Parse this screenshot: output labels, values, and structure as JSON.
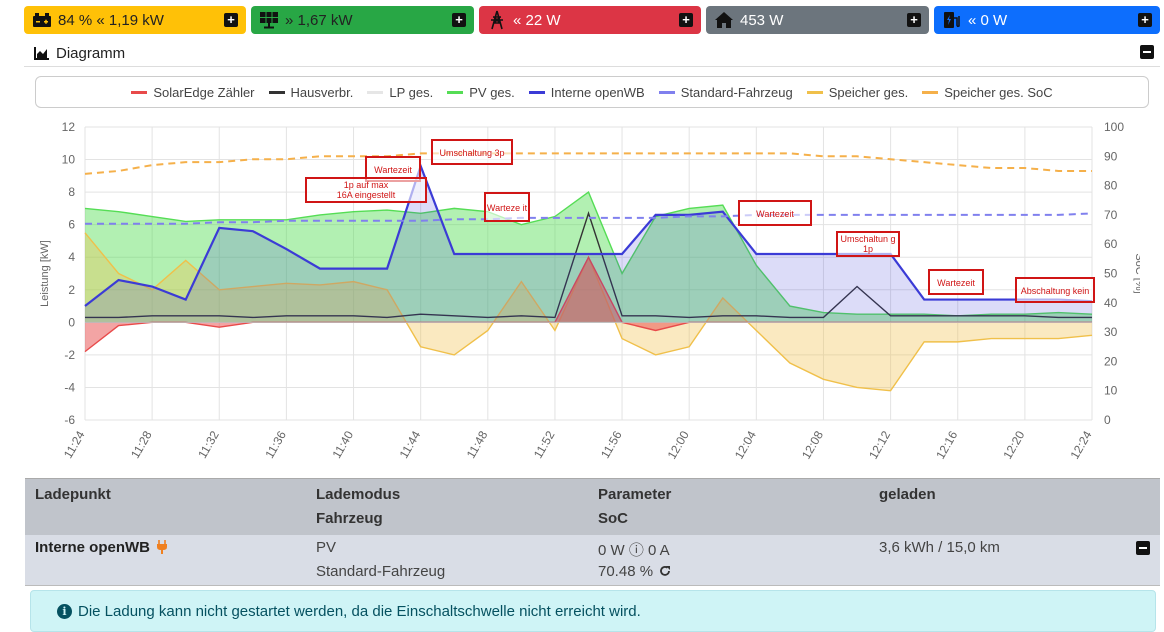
{
  "status_tiles": [
    {
      "name": "battery",
      "icon": "car-battery-icon",
      "value": "84 % « 1,19 kW",
      "color": "#ffc107"
    },
    {
      "name": "pv",
      "icon": "solar-panel-icon",
      "value": "» 1,67 kW",
      "color": "#28a745"
    },
    {
      "name": "grid",
      "icon": "power-tower-icon",
      "value": "« 22 W",
      "color": "#dc3545"
    },
    {
      "name": "house",
      "icon": "home-icon",
      "value": "453 W",
      "color": "#6c757d"
    },
    {
      "name": "charger",
      "icon": "charging-station-icon",
      "value": "« 0 W",
      "color": "#0d6efd"
    }
  ],
  "diagram": {
    "title": "Diagramm"
  },
  "legend": [
    {
      "label": "SolarEdge Zähler",
      "color": "#e84a4a"
    },
    {
      "label": "Hausverbr.",
      "color": "#333333"
    },
    {
      "label": "LP ges.",
      "color": "#e6e6e6"
    },
    {
      "label": "PV ges.",
      "color": "#55dd55"
    },
    {
      "label": "Interne openWB",
      "color": "#3b3bd6"
    },
    {
      "label": "Standard-Fahrzeug",
      "color": "#8080ee"
    },
    {
      "label": "Speicher ges.",
      "color": "#f0c04a"
    },
    {
      "label": "Speicher ges. SoC",
      "color": "#f5b04a"
    }
  ],
  "chart_data": {
    "type": "area",
    "ylabel": "Leistung [kW]",
    "y2label": "SoC [%]",
    "ylim": [
      -6,
      12
    ],
    "y2lim": [
      0,
      100
    ],
    "yticks": [
      "12",
      "10",
      "8",
      "6",
      "4",
      "2",
      "0",
      "-2",
      "-4",
      "-6"
    ],
    "y2ticks": [
      "100",
      "90",
      "80",
      "70",
      "60",
      "50",
      "40",
      "30",
      "20",
      "10",
      "0"
    ],
    "xticks": [
      "11:24",
      "11:28",
      "11:32",
      "11:36",
      "11:40",
      "11:44",
      "11:48",
      "11:52",
      "11:56",
      "12:00",
      "12:04",
      "12:08",
      "12:12",
      "12:16",
      "12:20",
      "12:24"
    ],
    "x_minutes": [
      0,
      2,
      4,
      6,
      8,
      10,
      12,
      14,
      16,
      18,
      20,
      22,
      24,
      26,
      28,
      30,
      32,
      34,
      36,
      38,
      40,
      42,
      44,
      46,
      48,
      50,
      52,
      54,
      56,
      58,
      60
    ],
    "series": [
      {
        "name": "PV ges.",
        "color": "#55dd55",
        "values": [
          7.0,
          6.8,
          6.5,
          6.2,
          6.3,
          6.3,
          6.3,
          6.6,
          6.8,
          6.9,
          6.7,
          7.0,
          6.8,
          6.0,
          6.5,
          8.0,
          3.0,
          6.5,
          7.0,
          7.2,
          3.5,
          1.0,
          0.6,
          0.5,
          0.5,
          0.5,
          0.4,
          0.5,
          0.5,
          0.6,
          0.5
        ]
      },
      {
        "name": "Speicher ges.",
        "color": "#f0c04a",
        "values": [
          5.5,
          3.0,
          2.0,
          3.8,
          2.0,
          2.2,
          2.4,
          2.3,
          2.5,
          2.0,
          -1.5,
          -2.0,
          -0.5,
          2.5,
          -0.5,
          4.0,
          -1.0,
          -2.0,
          -1.5,
          1.5,
          -0.5,
          -2.5,
          -3.5,
          -4.0,
          -4.2,
          -1.2,
          -1.2,
          -1.0,
          -1.0,
          -1.0,
          -0.8
        ]
      },
      {
        "name": "SolarEdge Zähler",
        "color": "#e84a4a",
        "values": [
          -1.8,
          -0.2,
          0.0,
          0.0,
          -0.3,
          0.0,
          0.0,
          0.0,
          0.0,
          0.0,
          0.0,
          0.0,
          0.0,
          0.0,
          0.0,
          4.0,
          0.0,
          -0.5,
          0.0,
          0.0,
          0.0,
          0.0,
          0.0,
          0.0,
          0.0,
          0.0,
          0.0,
          0.0,
          0.0,
          0.0,
          0.0
        ]
      },
      {
        "name": "Hausverbr.",
        "color": "#333333",
        "values": [
          0.3,
          0.3,
          0.4,
          0.4,
          0.4,
          0.3,
          0.4,
          0.4,
          0.4,
          0.3,
          0.5,
          0.4,
          0.3,
          0.4,
          0.3,
          6.7,
          0.4,
          0.4,
          0.3,
          0.4,
          0.4,
          0.3,
          0.3,
          2.2,
          0.4,
          0.4,
          0.4,
          0.4,
          0.4,
          0.3,
          0.3
        ]
      },
      {
        "name": "Interne openWB",
        "color": "#3b3bd6",
        "values": [
          1.0,
          2.6,
          2.2,
          1.4,
          5.8,
          5.6,
          4.5,
          3.3,
          3.3,
          3.3,
          9.6,
          4.2,
          4.2,
          4.2,
          4.2,
          4.2,
          4.2,
          6.6,
          6.6,
          6.8,
          4.2,
          4.2,
          4.2,
          4.2,
          4.2,
          1.4,
          1.4,
          1.4,
          1.4,
          1.4,
          1.3
        ]
      },
      {
        "name": "Speicher ges. SoC",
        "color": "#f5b04a",
        "axis": "right",
        "values": [
          84,
          85,
          87,
          88,
          88,
          89,
          89,
          90,
          90,
          90,
          91,
          91,
          91,
          91,
          91,
          91,
          91,
          91,
          91,
          91,
          91,
          91,
          90,
          90,
          89,
          88,
          87,
          86,
          86,
          85,
          85
        ]
      },
      {
        "name": "Standard-Fahrzeug",
        "color": "#8080ee",
        "axis": "right",
        "values": [
          67,
          67,
          67,
          67,
          67.5,
          67.5,
          68,
          68,
          68,
          68,
          68,
          68.5,
          68.5,
          69,
          69,
          69,
          69,
          69,
          69.5,
          69.5,
          70,
          70,
          70,
          70,
          70,
          70,
          70,
          70,
          70,
          70,
          70.5
        ]
      }
    ],
    "annotations": [
      "Wartezeit",
      "Umschaltung 3p",
      "1p auf max 16A eingestellt",
      "Warteze it",
      "Wartezeit",
      "Umschaltun g 1p",
      "Wartezeit",
      "Abschaltung kein"
    ]
  },
  "table": {
    "headers": [
      [
        "Ladepunkt",
        ""
      ],
      [
        "Lademodus",
        "Fahrzeug"
      ],
      [
        "Parameter",
        "SoC"
      ],
      [
        "geladen",
        ""
      ]
    ],
    "row": {
      "name": "Interne openWB",
      "mode": "PV",
      "vehicle": "Standard-Fahrzeug",
      "param": "0 W ⓘ 0 A",
      "soc": "70.48 %",
      "charged": "3,6 kWh / 15,0 km"
    }
  },
  "alert": {
    "text": "Die Ladung kann nicht gestartet werden, da die Einschaltschwelle nicht erreicht wird."
  }
}
